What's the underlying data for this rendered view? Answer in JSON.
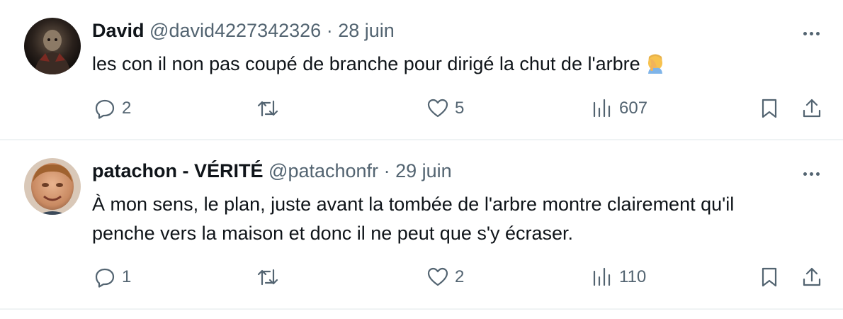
{
  "tweets": [
    {
      "name": "David",
      "handle": "@david4227342326",
      "separator": "·",
      "date": "28 juin",
      "text": "les con il non pas coupé de branche pour dirigé la chut de l'arbre",
      "emoji": "face-palm-emoji",
      "replies": "2",
      "retweets": "",
      "likes": "5",
      "views": "607"
    },
    {
      "name": "patachon - VÉRITÉ",
      "handle": "@patachonfr",
      "separator": "·",
      "date": "29 juin",
      "text_line1": "À mon sens, le plan, juste avant la tombée de l'arbre montre clairement qu'il",
      "text_line2": "penche vers la maison et donc il ne peut que s'y écraser.",
      "replies": "1",
      "retweets": "",
      "likes": "2",
      "views": "110"
    }
  ],
  "colors": {
    "text_primary": "#0f1419",
    "text_secondary": "#536471",
    "divider": "#eff3f4"
  },
  "icons": [
    "reply-icon",
    "retweet-icon",
    "like-icon",
    "views-icon",
    "bookmark-icon",
    "share-icon",
    "more-icon"
  ]
}
